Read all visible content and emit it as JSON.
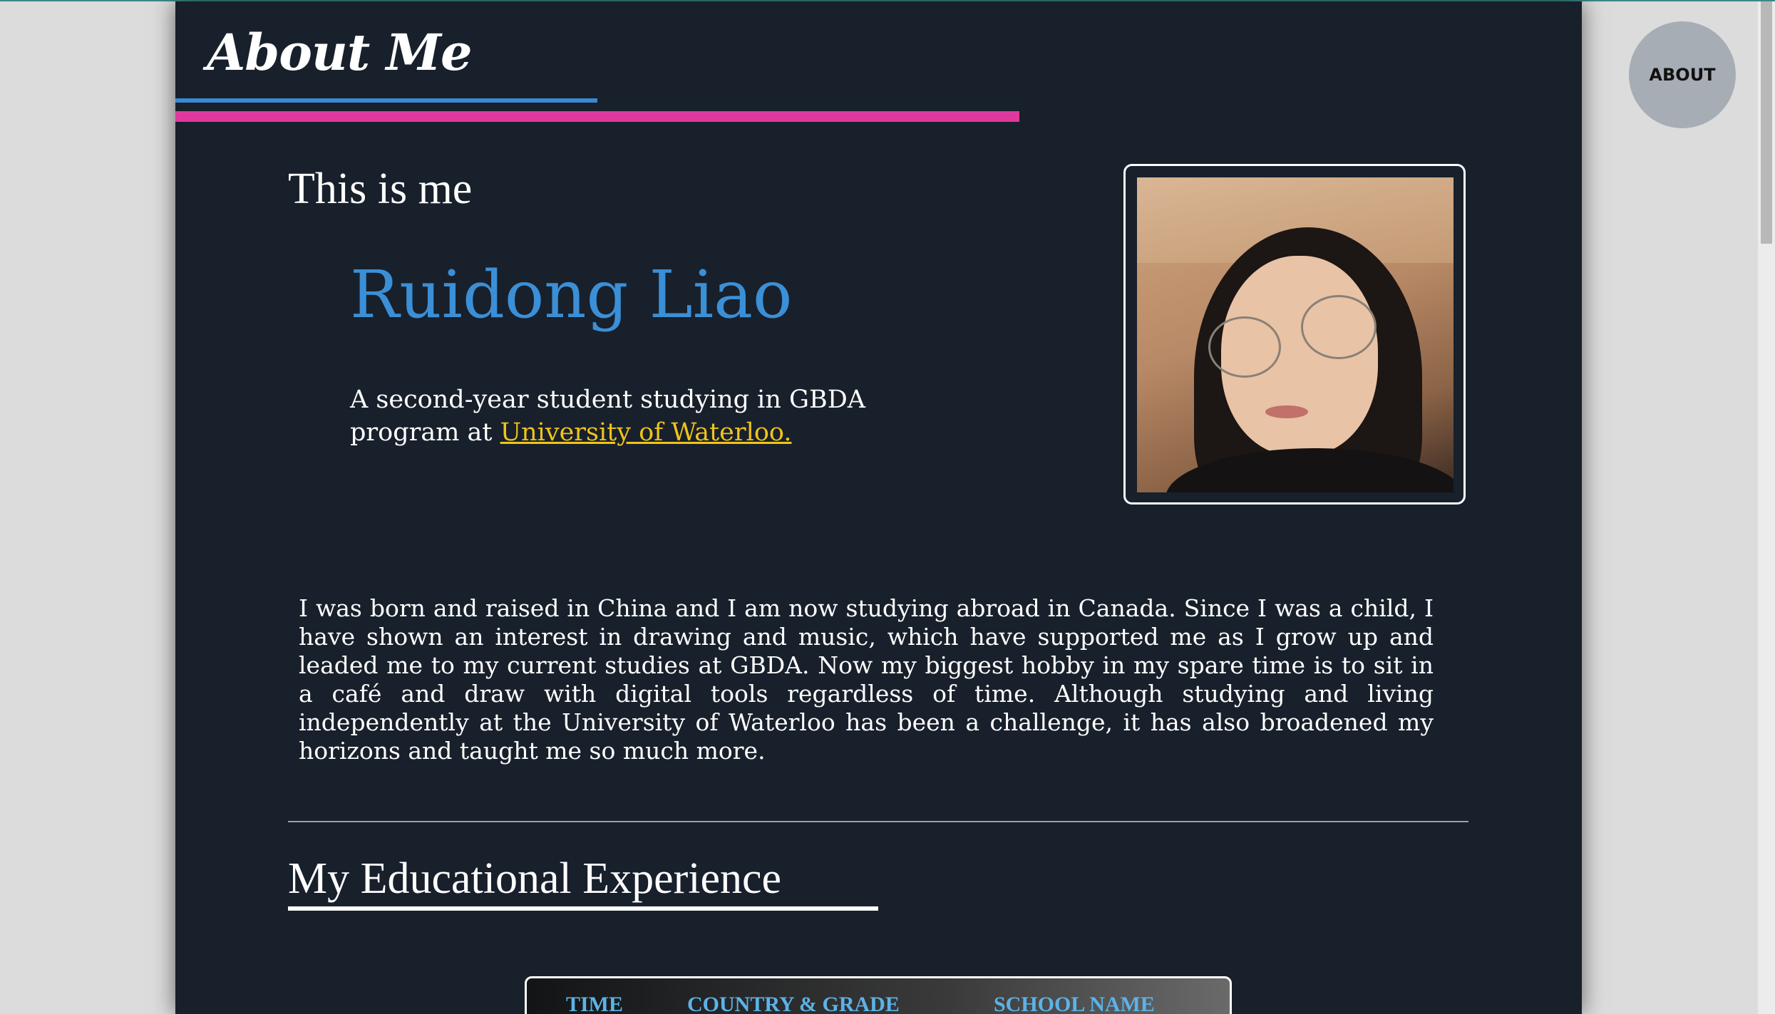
{
  "header": {
    "title": "About Me"
  },
  "nav": {
    "about_label": "ABOUT"
  },
  "intro": {
    "heading": "This is me",
    "name": "Ruidong Liao",
    "tagline_prefix": "A second-year student studying in GBDA program at ",
    "tagline_link": "University of Waterloo."
  },
  "photo": {
    "alt": "Ruidong Liao portrait"
  },
  "bio": {
    "text": "I was born and raised in China and I am now studying abroad in Canada. Since I was a child, I have shown an interest in drawing and music, which have supported me as I grow up and leaded me to my current studies at GBDA. Now my biggest hobby in my spare time is to sit in a café and draw with digital tools regardless of time. Although studying and living independently at the University of Waterloo has been a challenge, it has also broadened my horizons and taught me so much more."
  },
  "education": {
    "heading": "My Educational Experience",
    "columns": [
      "TIME",
      "COUNTRY & GRADE",
      "SCHOOL NAME"
    ]
  },
  "colors": {
    "page_bg": "#18202b",
    "accent_blue": "#3b88d4",
    "accent_pink": "#e0399e",
    "link_yellow": "#f0c419",
    "table_header": "#5bb3e8"
  }
}
